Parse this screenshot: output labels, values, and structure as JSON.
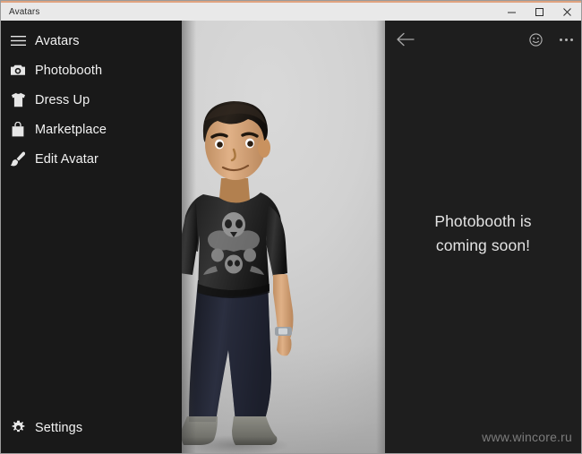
{
  "window": {
    "title": "Avatars",
    "accent_color": "#e0a380",
    "titlebar_bg": "#e9e9e9",
    "caption_buttons": [
      {
        "name": "minimize",
        "glyph": "minimize-icon"
      },
      {
        "name": "maximize",
        "glyph": "maximize-icon"
      },
      {
        "name": "close",
        "glyph": "close-icon"
      }
    ]
  },
  "sidebar": {
    "bg_color": "#191919",
    "items": [
      {
        "icon": "hamburger-menu-icon",
        "label": "Avatars"
      },
      {
        "icon": "camera-icon",
        "label": "Photobooth"
      },
      {
        "icon": "tshirt-icon",
        "label": "Dress Up"
      },
      {
        "icon": "shopping-bag-icon",
        "label": "Marketplace"
      },
      {
        "icon": "paintbrush-icon",
        "label": "Edit Avatar"
      }
    ],
    "footer": {
      "icon": "gear-icon",
      "label": "Settings"
    }
  },
  "avatar_stage": {
    "background": "light-gray-gradient",
    "figure": {
      "description": "3D Xbox-style male avatar standing",
      "hair_color": "#1b1713",
      "skin_color": "#d9a87c",
      "shirt_color": "#2a2a2a",
      "shirt_graphic": "skull-emblem",
      "pants_color": "#232738",
      "shoe_color": "#7a7a72",
      "accessory": "wristwatch"
    }
  },
  "right_pane": {
    "bg_color": "#1e1e1e",
    "toolbar": {
      "back": {
        "icon": "back-arrow-icon",
        "label": "Back"
      },
      "actions": [
        {
          "icon": "smiley-face-icon",
          "label": "Emoji"
        },
        {
          "icon": "ellipsis-icon",
          "label": "More"
        }
      ]
    },
    "message": "Photobooth is coming soon!",
    "watermark": "www.wincore.ru"
  }
}
